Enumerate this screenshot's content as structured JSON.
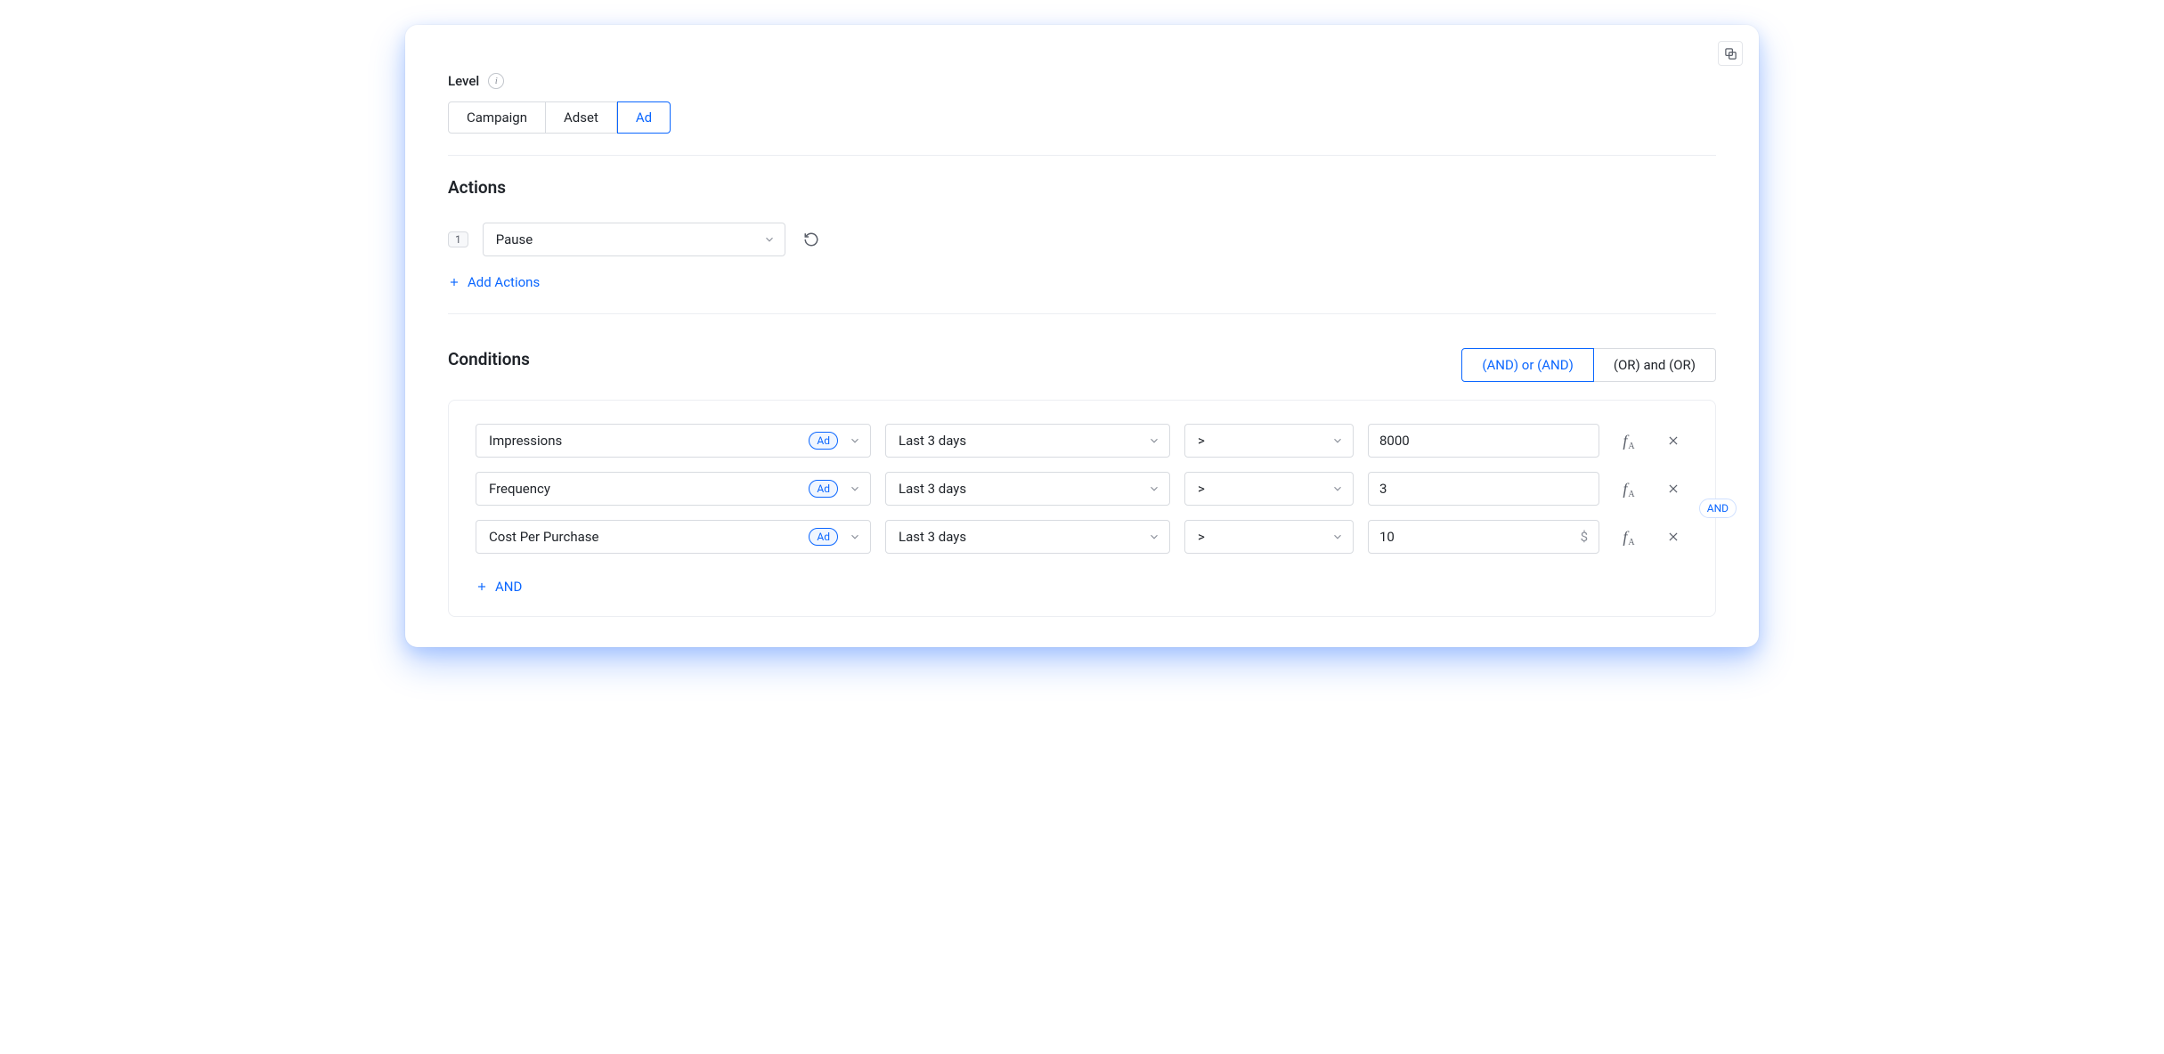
{
  "level": {
    "label": "Level",
    "tabs": [
      "Campaign",
      "Adset",
      "Ad"
    ],
    "active": "Ad"
  },
  "actions": {
    "heading": "Actions",
    "step": "1",
    "selected": "Pause",
    "add_label": "Add Actions"
  },
  "conditions": {
    "heading": "Conditions",
    "logic_options": [
      "(AND) or (AND)",
      "(OR) and (OR)"
    ],
    "logic_active": "(AND) or (AND)",
    "rows": [
      {
        "metric": "Impressions",
        "scope_badge": "Ad",
        "window": "Last 3 days",
        "op": ">",
        "value": "8000",
        "suffix": ""
      },
      {
        "metric": "Frequency",
        "scope_badge": "Ad",
        "window": "Last 3 days",
        "op": ">",
        "value": "3",
        "suffix": ""
      },
      {
        "metric": "Cost Per Purchase",
        "scope_badge": "Ad",
        "window": "Last 3 days",
        "op": ">",
        "value": "10",
        "suffix": "$"
      }
    ],
    "add_label": "AND",
    "edge_pill": "AND"
  }
}
